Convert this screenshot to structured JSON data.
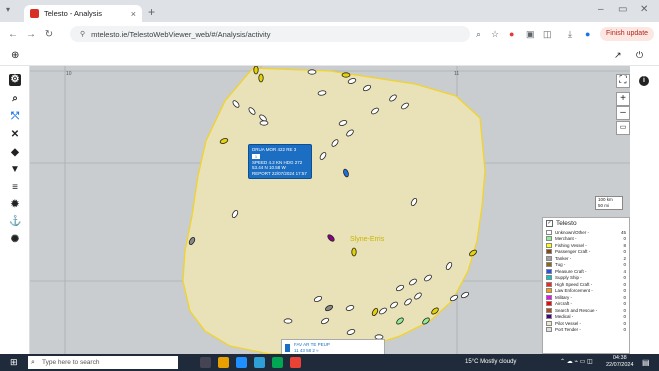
{
  "browser": {
    "tab_title": "Telesto - Analysis",
    "url": "mtelesto.ie/TelestoWebViewer_web/#/Analysis/activity",
    "update_label": "Finish update"
  },
  "map": {
    "area_label": "Slyne-Erris",
    "grid_labels": [
      "10",
      "11"
    ],
    "popup": {
      "lines": [
        "DRUA MOR 422 RE 3",
        "",
        "SPEED 4.2 KN  HDG 272",
        "53.44 N  10.58 W",
        "REPORT 22/07/2024 17:57"
      ],
      "badge": "1"
    },
    "bottom_popup": {
      "lines": [
        "FAV AR TE PEUP",
        "11 43 58 2 ≈"
      ]
    },
    "scale": {
      "line1": "100 km",
      "line2": "50 mi"
    }
  },
  "legend": {
    "title": "Telesto",
    "check": "✓",
    "rows": [
      {
        "name": "Unknown/Other -",
        "count": "45",
        "color": "#ffffff"
      },
      {
        "name": "Merchant -",
        "count": "0",
        "color": "#90ee90"
      },
      {
        "name": "Fishing Vessel -",
        "count": "8",
        "color": "#ffff00"
      },
      {
        "name": "Passenger Craft -",
        "count": "0",
        "color": "#8b4513"
      },
      {
        "name": "Tanker -",
        "count": "2",
        "color": "#a0a0a0"
      },
      {
        "name": "Tug -",
        "count": "0",
        "color": "#8b6914"
      },
      {
        "name": "Pleasure Craft -",
        "count": "4",
        "color": "#1e50ff"
      },
      {
        "name": "Supply Ship -",
        "count": "0",
        "color": "#00c8c8"
      },
      {
        "name": "High Speed Craft -",
        "count": "0",
        "color": "#ff2020"
      },
      {
        "name": "Law Enforcement -",
        "count": "0",
        "color": "#ff9900"
      },
      {
        "name": "Military -",
        "count": "0",
        "color": "#ff00ff"
      },
      {
        "name": "Aircraft -",
        "count": "0",
        "color": "#ff0000"
      },
      {
        "name": "Search and Rescue -",
        "count": "0",
        "color": "#b04a1b"
      },
      {
        "name": "Medical -",
        "count": "0",
        "color": "#4b0082"
      },
      {
        "name": "Pilot Vessel -",
        "count": "0",
        "color": "#f2e6c9"
      },
      {
        "name": "Port Tender -",
        "count": "0",
        "color": "#e0e0e0"
      }
    ]
  },
  "colors": {
    "area_fill": "#e9e2b8",
    "area_stroke": "#f2d32a",
    "vessel_yellow": "#e6d200",
    "vessel_white": "#ffffff"
  },
  "taskbar": {
    "search_placeholder": "Type here to search",
    "weather": "15°C  Mostly cloudy",
    "time": "04:38",
    "date": "22/07/2024"
  },
  "icons": [
    "search-icon",
    "gear-icon",
    "layers-icon",
    "filter-icon",
    "fullscreen-icon",
    "info-icon",
    "zoom-in-icon",
    "zoom-out-icon"
  ]
}
